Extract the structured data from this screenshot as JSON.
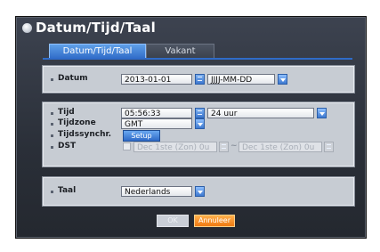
{
  "dialog": {
    "title": "Datum/Tijd/Taal",
    "tabs": [
      {
        "label": "Datum/Tijd/Taal",
        "active": true
      },
      {
        "label": "Vakant",
        "active": false
      }
    ]
  },
  "date_section": {
    "datum_label": "Datum",
    "datum_value": "2013-01-01",
    "format_value": "JJJJ-MM-DD"
  },
  "time_section": {
    "tijd_label": "Tijd",
    "tijd_value": "05:56:33",
    "clock_format": "24 uur",
    "tijdzone_label": "Tijdzone",
    "tijdzone_value": "GMT",
    "sync_label": "Tijdssynchr.",
    "sync_button": "Setup",
    "dst_label": "DST",
    "dst_start": "Dec 1ste (Zon) 0u",
    "dst_separator": "~",
    "dst_end": "Dec 1ste (Zon) 0u"
  },
  "language_section": {
    "taal_label": "Taal",
    "taal_value": "Nederlands"
  },
  "buttons": {
    "ok": "OK",
    "cancel": "Annuleer"
  },
  "colors": {
    "accent_blue": "#2f6bc8",
    "cancel_orange": "#f07a12"
  }
}
